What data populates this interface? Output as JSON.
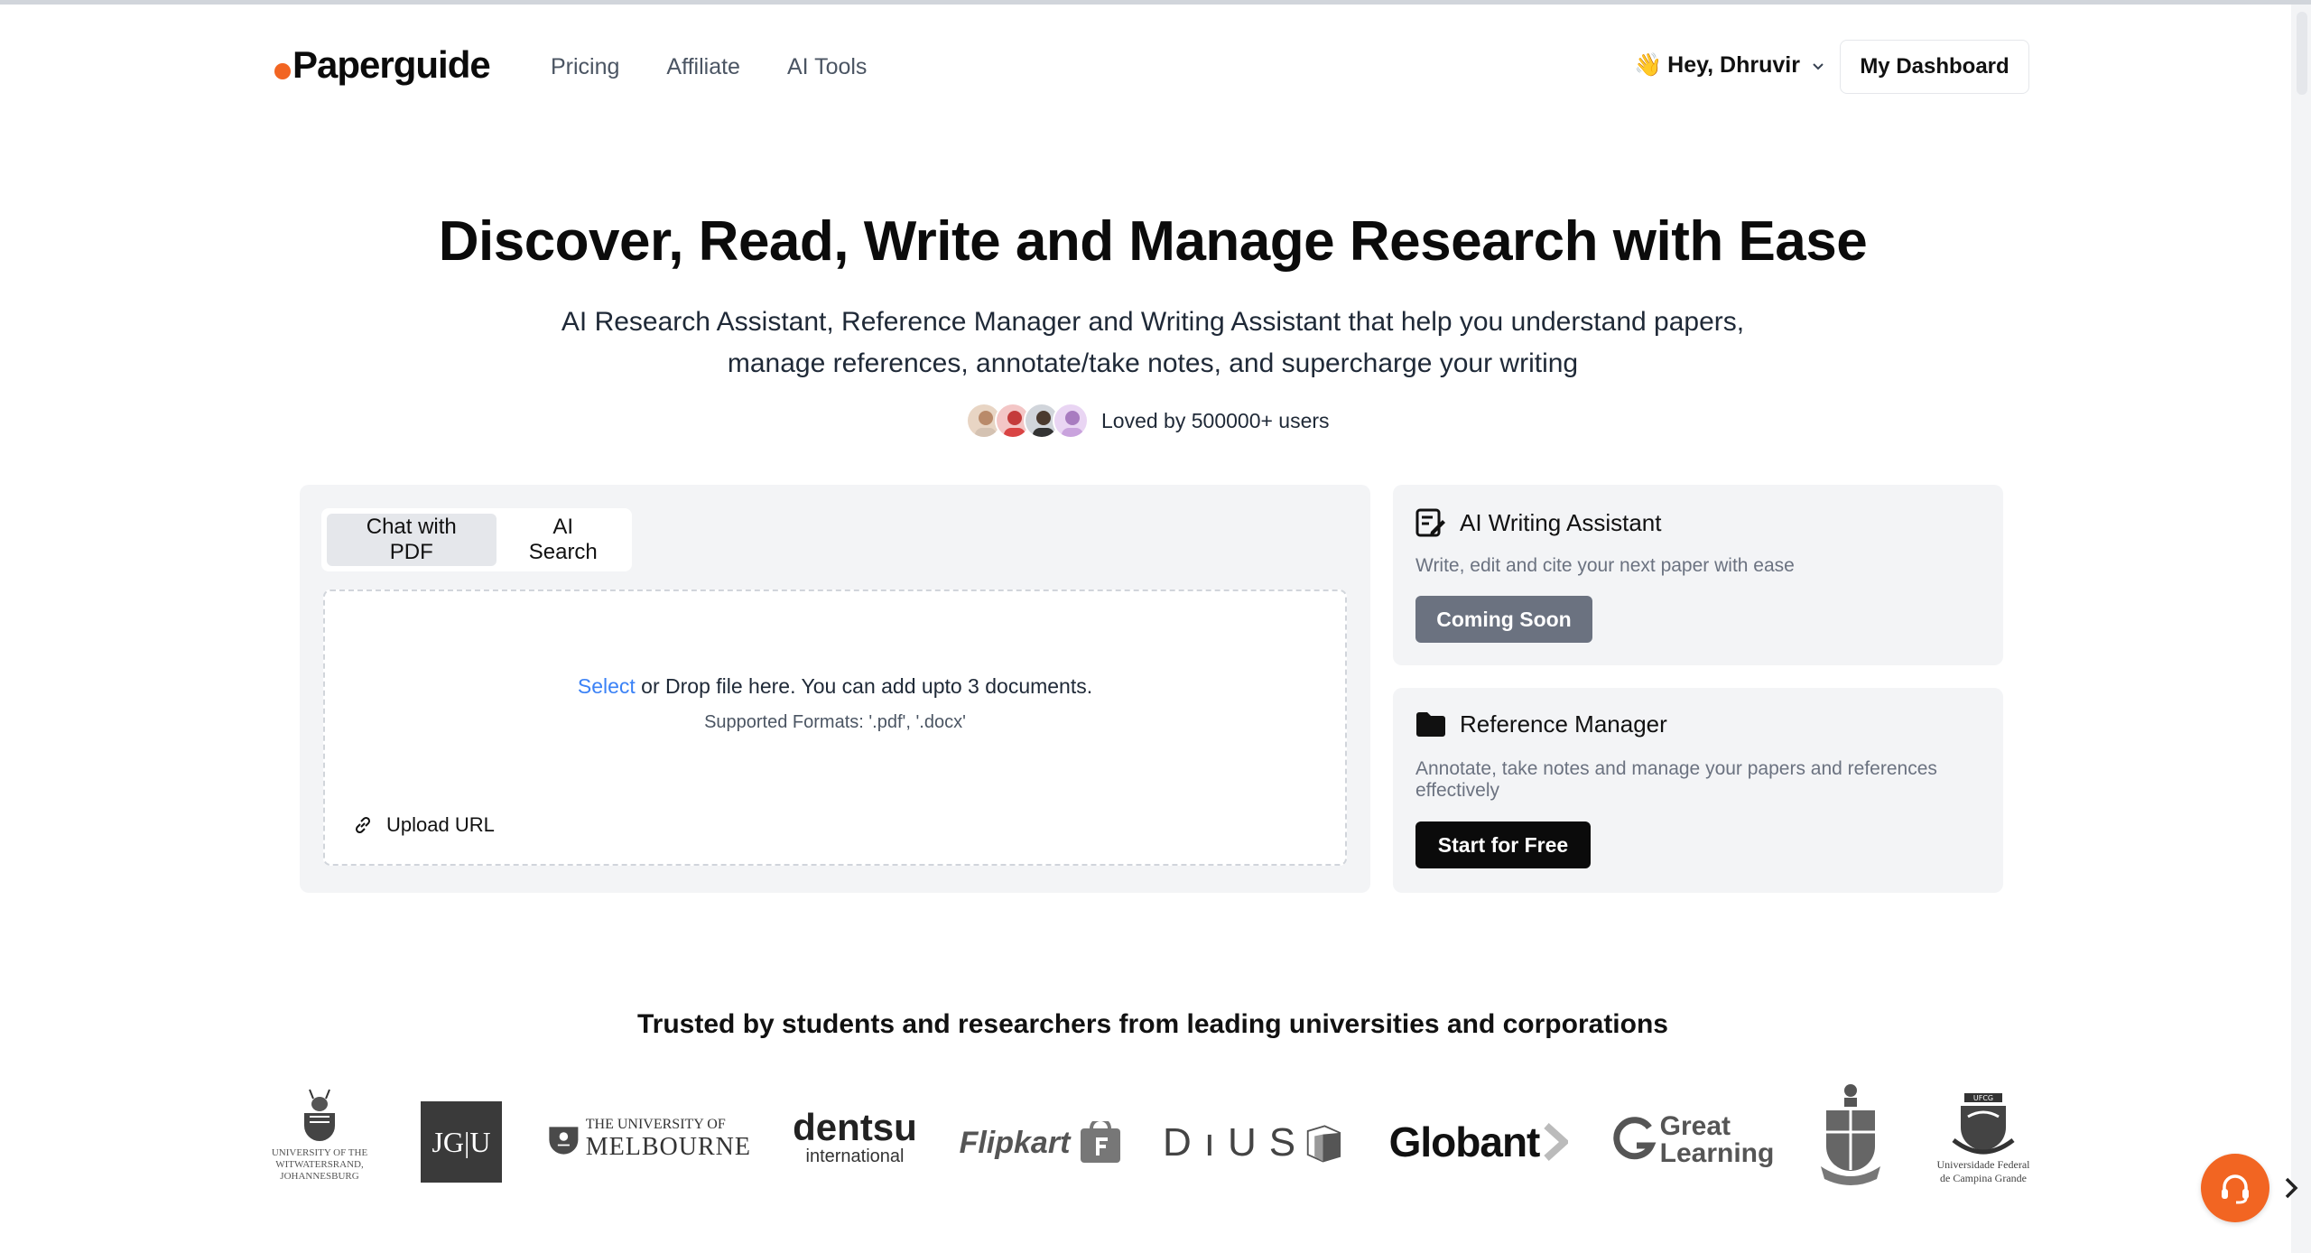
{
  "header": {
    "logo_text": "Paperguide",
    "nav": [
      "Pricing",
      "Affiliate",
      "AI Tools"
    ],
    "greeting_emoji": "👋",
    "greeting": "Hey, Dhruvir",
    "dashboard_button": "My Dashboard"
  },
  "hero": {
    "title": "Discover, Read, Write and Manage Research with Ease",
    "subtitle": "AI Research Assistant, Reference Manager and Writing Assistant that help you understand papers, manage references, annotate/take notes, and supercharge your writing",
    "loved_text": "Loved by 500000+ users"
  },
  "upload_card": {
    "tabs": [
      "Chat with PDF",
      "AI Search"
    ],
    "active_tab": "Chat with PDF",
    "select_link": "Select",
    "drop_text": " or Drop file here. You can add upto 3 documents.",
    "formats": "Supported Formats: '.pdf', '.docx'",
    "upload_url": "Upload URL"
  },
  "writing_card": {
    "title": "AI Writing Assistant",
    "description": "Write, edit and cite your next paper with ease",
    "button": "Coming Soon"
  },
  "reference_card": {
    "title": "Reference Manager",
    "description": "Annotate, take notes and manage your papers and references effectively",
    "button": "Start for Free"
  },
  "trusted": {
    "heading": "Trusted by students and researchers from leading universities and corporations",
    "logos": {
      "wits": [
        "UNIVERSITY OF THE",
        "WITWATERSRAND,",
        "JOHANNESBURG"
      ],
      "jgu": "JG|U",
      "melbourne_small": "THE UNIVERSITY OF",
      "melbourne_big": "MELBOURNE",
      "dentsu_big": "dentsu",
      "dentsu_small": "international",
      "flipkart": "Flipkart",
      "dius": "DıUS",
      "globant": "Globant",
      "great_learning": [
        "Great",
        "Learning"
      ],
      "ufcg": [
        "Universidade Federal",
        "de Campina Grande"
      ],
      "ufcg_badge": "UFCG"
    }
  },
  "colors": {
    "brand_orange": "#f26522",
    "link_blue": "#3b82f6",
    "card_bg": "#f3f4f6",
    "coming_soon_bg": "#6b7280",
    "primary_dark": "#0b0b0b"
  },
  "icons": {
    "support": "headset-icon",
    "next": "chevron-right-icon",
    "writing": "pen-note-icon",
    "reference": "folder-icon",
    "link": "link-icon"
  }
}
